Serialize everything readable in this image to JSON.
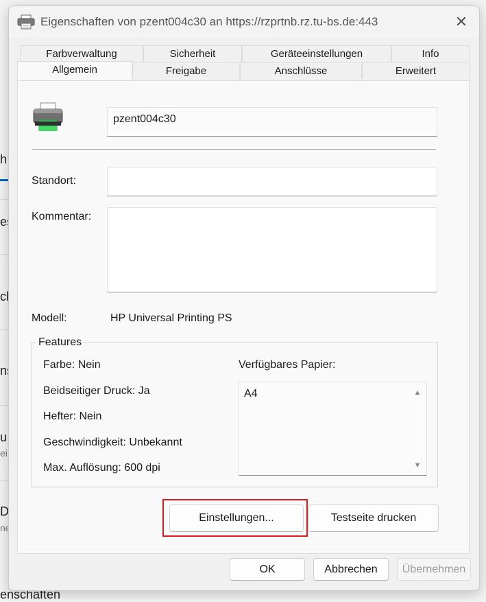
{
  "background": {
    "fragments": [
      "h",
      "es",
      "ck",
      "ns",
      "u",
      "ei",
      "Dr",
      "ne",
      "enschaften"
    ],
    "accent_color": "#0067c0"
  },
  "dialog": {
    "title": "Eigenschaften von pzent004c30 an https://rzprtnb.rz.tu-bs.de:443",
    "title_icon": "printer-icon",
    "close_glyph": "✕",
    "tabs_back": [
      "Farbverwaltung",
      "Sicherheit",
      "Geräteeinstellungen",
      "Info"
    ],
    "tabs_front": [
      "Allgemein",
      "Freigabe",
      "Anschlüsse",
      "Erweitert"
    ],
    "active_tab": "Allgemein"
  },
  "general": {
    "printer_name": "pzent004c30",
    "location_label": "Standort:",
    "location_value": "",
    "comment_label": "Kommentar:",
    "comment_value": "",
    "model_label": "Modell:",
    "model_value": "HP Universal Printing PS"
  },
  "features": {
    "title": "Features",
    "items": [
      "Farbe: Nein",
      "Beidseitiger Druck: Ja",
      "Hefter: Nein",
      "Geschwindigkeit: Unbekannt",
      "Max. Auflösung: 600 dpi"
    ],
    "paper_label": "Verfügbares Papier:",
    "paper_items": [
      "A4"
    ],
    "scroll_up_glyph": "▲",
    "scroll_down_glyph": "▼"
  },
  "buttons": {
    "settings": "Einstellungen...",
    "test_page": "Testseite drucken",
    "ok": "OK",
    "cancel": "Abbrechen",
    "apply": "Übernehmen"
  },
  "colors": {
    "highlight": "#e0191f",
    "printer_green": "#3cc85a"
  }
}
